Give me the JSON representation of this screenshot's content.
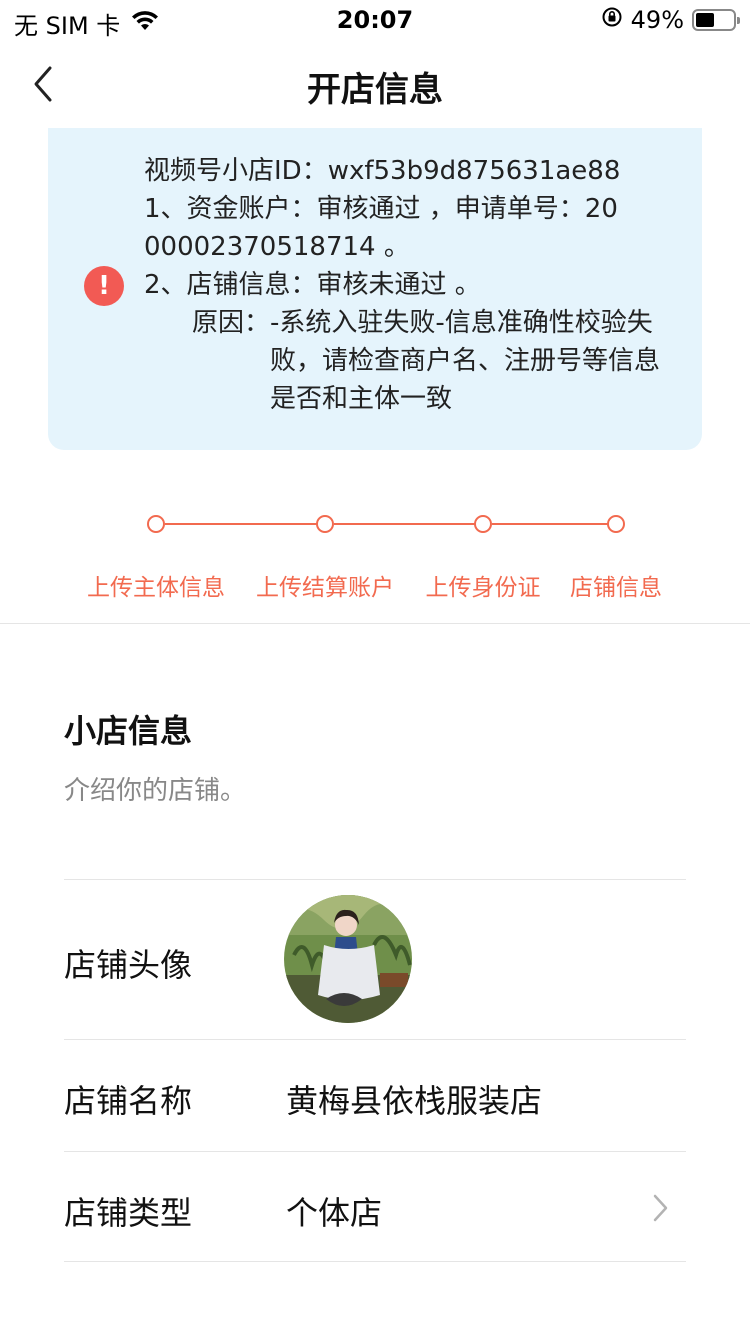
{
  "status_bar": {
    "carrier": "无 SIM 卡",
    "time": "20:07",
    "battery_percent": "49%",
    "battery_level": 0.49,
    "icons": [
      "wifi-icon",
      "orientation-lock-icon",
      "battery-icon"
    ]
  },
  "nav": {
    "title": "开店信息",
    "back_icon": "chevron-left-icon"
  },
  "notice": {
    "icon": "alert-icon",
    "line1": "视频号小店ID：wxf53b9d875631ae88",
    "line2": "1、资金账户：审核通过 ，申请单号：20",
    "line3": "00002370518714 。",
    "line4": "2、店铺信息：审核未通过 。",
    "reason_label": "原因：",
    "reason_text": "-系统入驻失败-信息准确性校验失败，请检查商户名、注册号等信息是否和主体一致"
  },
  "steps": [
    {
      "label": "上传主体信息"
    },
    {
      "label": "上传结算账户"
    },
    {
      "label": "上传身份证"
    },
    {
      "label": "店铺信息"
    }
  ],
  "section": {
    "title": "小店信息",
    "subtitle": "介绍你的店铺。"
  },
  "rows": {
    "avatar_label": "店铺头像",
    "name_label": "店铺名称",
    "name_value": "黄梅县依栈服装店",
    "type_label": "店铺类型",
    "type_value": "个体店"
  },
  "colors": {
    "accent": "#f26a4f",
    "notice_bg": "#e5f4fc",
    "alert": "#f25a54"
  }
}
